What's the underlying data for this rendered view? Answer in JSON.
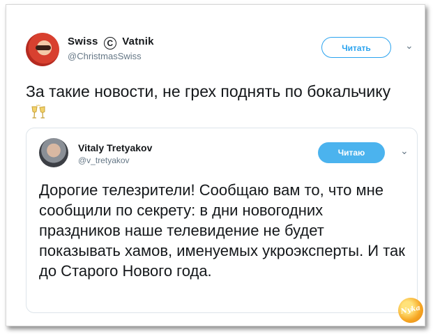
{
  "tweet": {
    "author": {
      "name_part1": "Swiss",
      "copyright_symbol": "C",
      "name_part2": "Vatnik",
      "handle": "@ChristmasSwiss"
    },
    "follow_label": "Читать",
    "text": "За такие новости, не грех поднять по бокальчику",
    "emoji": "clinking-glasses-icon"
  },
  "quoted_tweet": {
    "author": {
      "name": "Vitaly Tretyakov",
      "handle": "@v_tretyakov"
    },
    "follow_label": "Читаю",
    "text": "Дорогие телезрители! Сообщаю вам то, что мне сообщили по секрету: в дни новогодних праздников наше телевидение не будет показывать хамов, именуемых укроэксперты. И так до Старого Нового года."
  },
  "watermark": {
    "text": "Nyka"
  },
  "colors": {
    "accent": "#2aa3ef",
    "follow_filled": "#4bb3ee",
    "text": "#14171a",
    "muted": "#657786",
    "border": "#dde4ea"
  }
}
